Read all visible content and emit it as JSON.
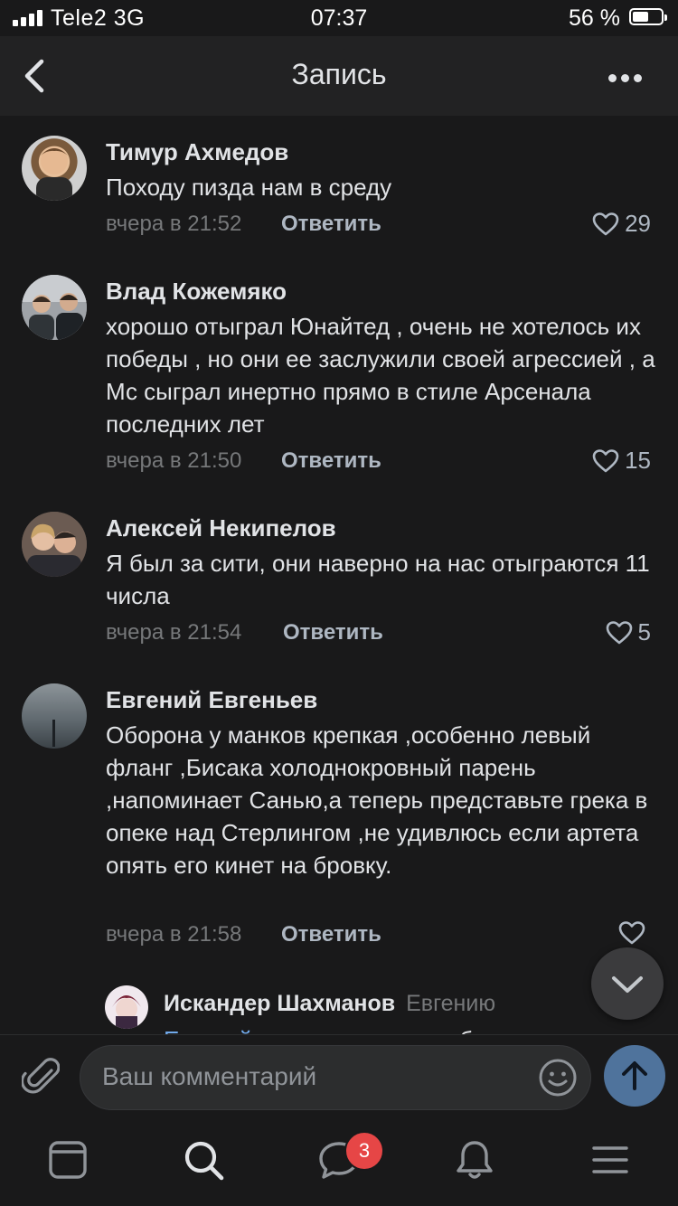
{
  "status_bar": {
    "carrier": "Tele2",
    "network": "3G",
    "time": "07:37",
    "battery": "56 %",
    "battery_level": 0.56
  },
  "header": {
    "title": "Запись",
    "back_icon": "chevron-left-icon",
    "more_icon": "more-horizontal-icon"
  },
  "comments": [
    {
      "author": "Тимур Ахмедов",
      "text": "Походу пизда нам в среду",
      "time": "вчера в 21:52",
      "reply_label": "Ответить",
      "likes": "29"
    },
    {
      "author": "Влад Кожемяко",
      "text": "хорошо отыграл Юнайтед , очень не хотелось их победы , но они ее заслужили своей агрессией , а Мс сыграл инертно прямо в стиле Арсенала последних лет",
      "time": "вчера в 21:50",
      "reply_label": "Ответить",
      "likes": "15"
    },
    {
      "author": "Алексей Некипелов",
      "text": "Я был за сити, они наверно на нас отыграются 11 числа",
      "time": "вчера в 21:54",
      "reply_label": "Ответить",
      "likes": "5"
    },
    {
      "author": "Евгений Евгеньев",
      "text": "Оборона у манков крепкая ,особенно левый фланг ,Бисака холоднокровный парень ,напоминает Санью,а теперь представьте грека в опеке над Стерлингом ,не удивлюсь если артета опять его кинет на бровку.",
      "time": "вчера в 21:58",
      "reply_label": "Ответить",
      "likes": ""
    }
  ],
  "nested_reply": {
    "author": "Искандер Шахманов",
    "reply_to": "Евгению",
    "text_link": "Евгений",
    "text": ", уж очень хочется быстрее"
  },
  "composer": {
    "placeholder": "Ваш комментарий",
    "attach_icon": "paperclip-icon",
    "emoji_icon": "smile-icon",
    "send_icon": "arrow-up-icon"
  },
  "tabbar": {
    "tabs": [
      "feed-icon",
      "search-icon",
      "messages-icon",
      "notifications-icon",
      "menu-icon"
    ],
    "messages_badge": "3"
  },
  "colors": {
    "background": "#19191a",
    "accent": "#4f739c",
    "link": "#71aaeb",
    "badge": "#e64646"
  }
}
